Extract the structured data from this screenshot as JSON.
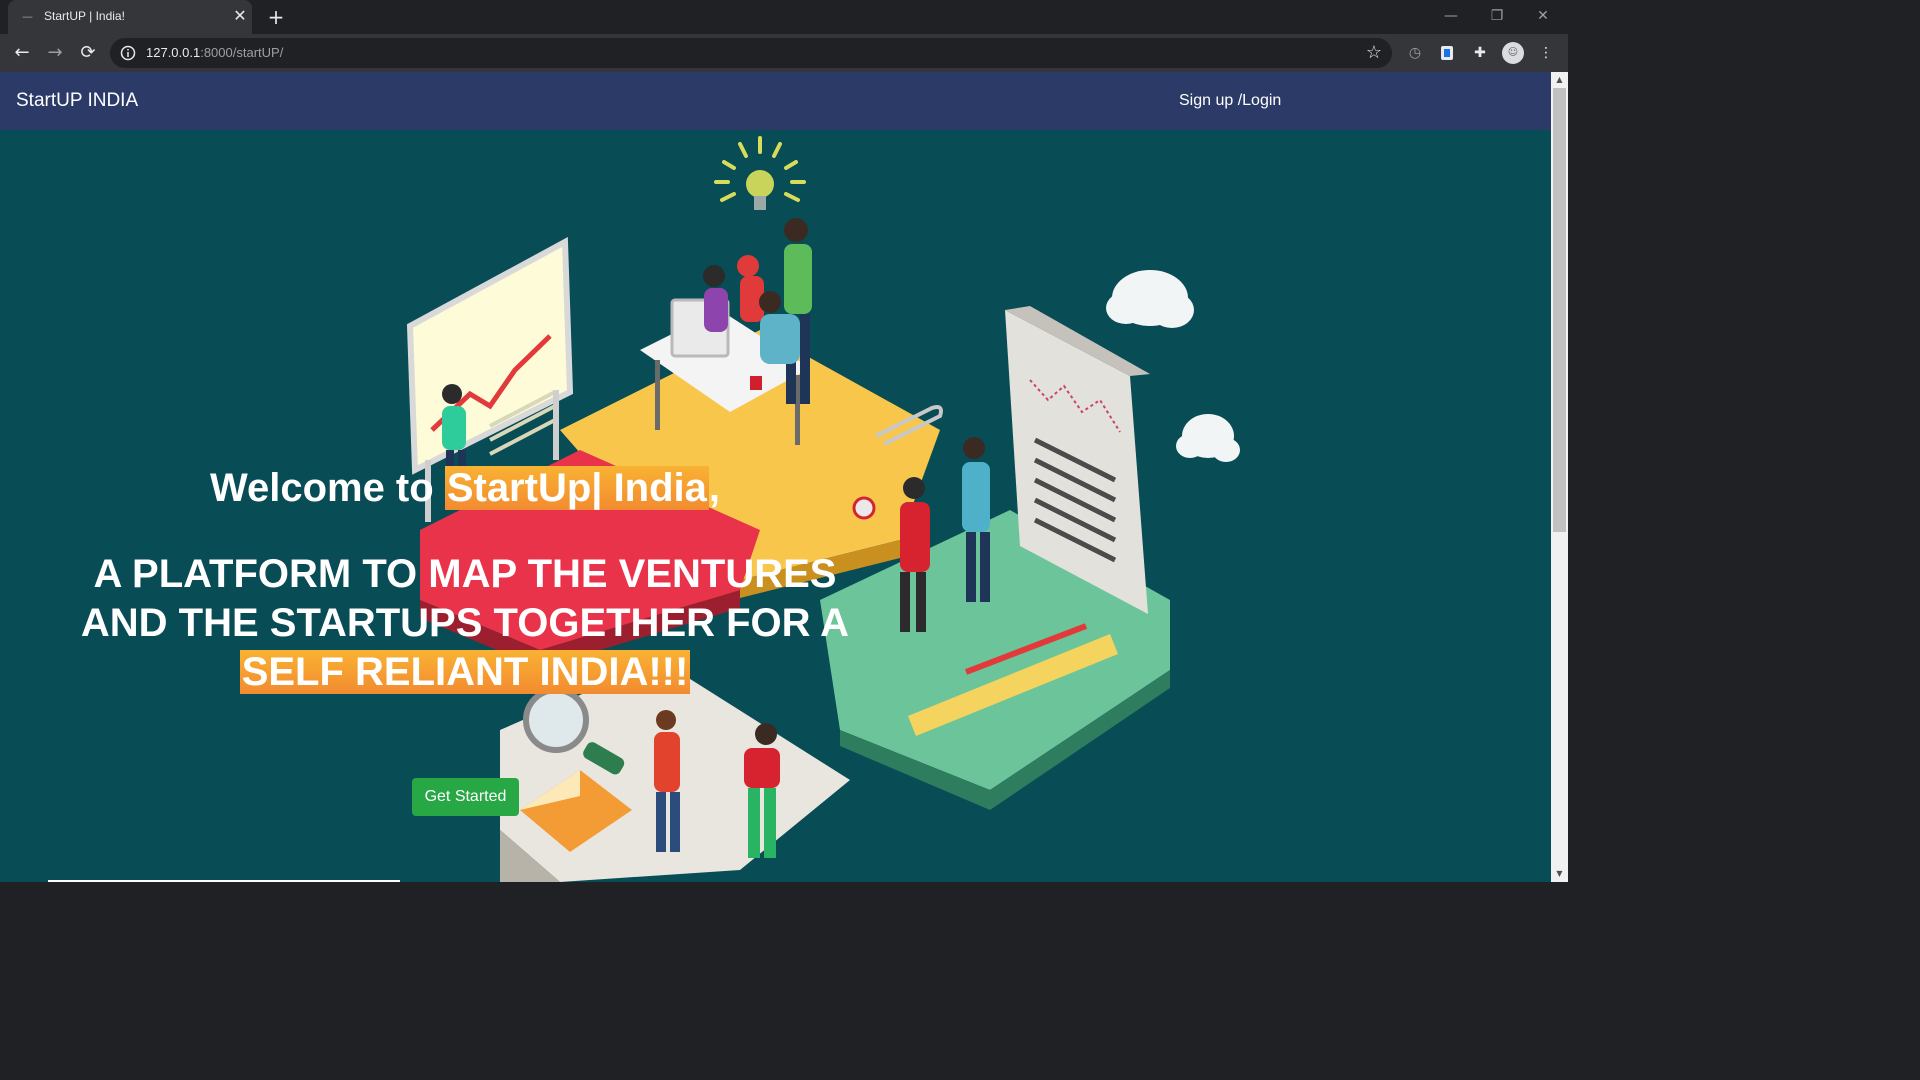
{
  "browser": {
    "tab_title": "StartUP | India!",
    "tab_close": "✕",
    "new_tab": "+",
    "url_host": "127.0.0.1",
    "url_path": ":8000/startUP/",
    "controls": {
      "minimize": "—",
      "restore": "❐",
      "close": "✕"
    }
  },
  "navbar": {
    "brand": "StartUP INDIA",
    "login_link": "Sign up /Login"
  },
  "hero": {
    "welcome_prefix": "Welcome to ",
    "welcome_highlight": "StartUp| India",
    "welcome_suffix": ",",
    "tagline_line1": "A PLATFORM TO MAP THE VENTURES",
    "tagline_line2": "AND THE STARTUPS TOGETHER FOR A",
    "tagline_highlight": "SELF RELIANT INDIA!!!",
    "cta_label": "Get Started"
  },
  "colors": {
    "navbar": "#2b3a67",
    "background": "#084c55",
    "highlight": "#f9b233",
    "cta": "#28a745"
  }
}
